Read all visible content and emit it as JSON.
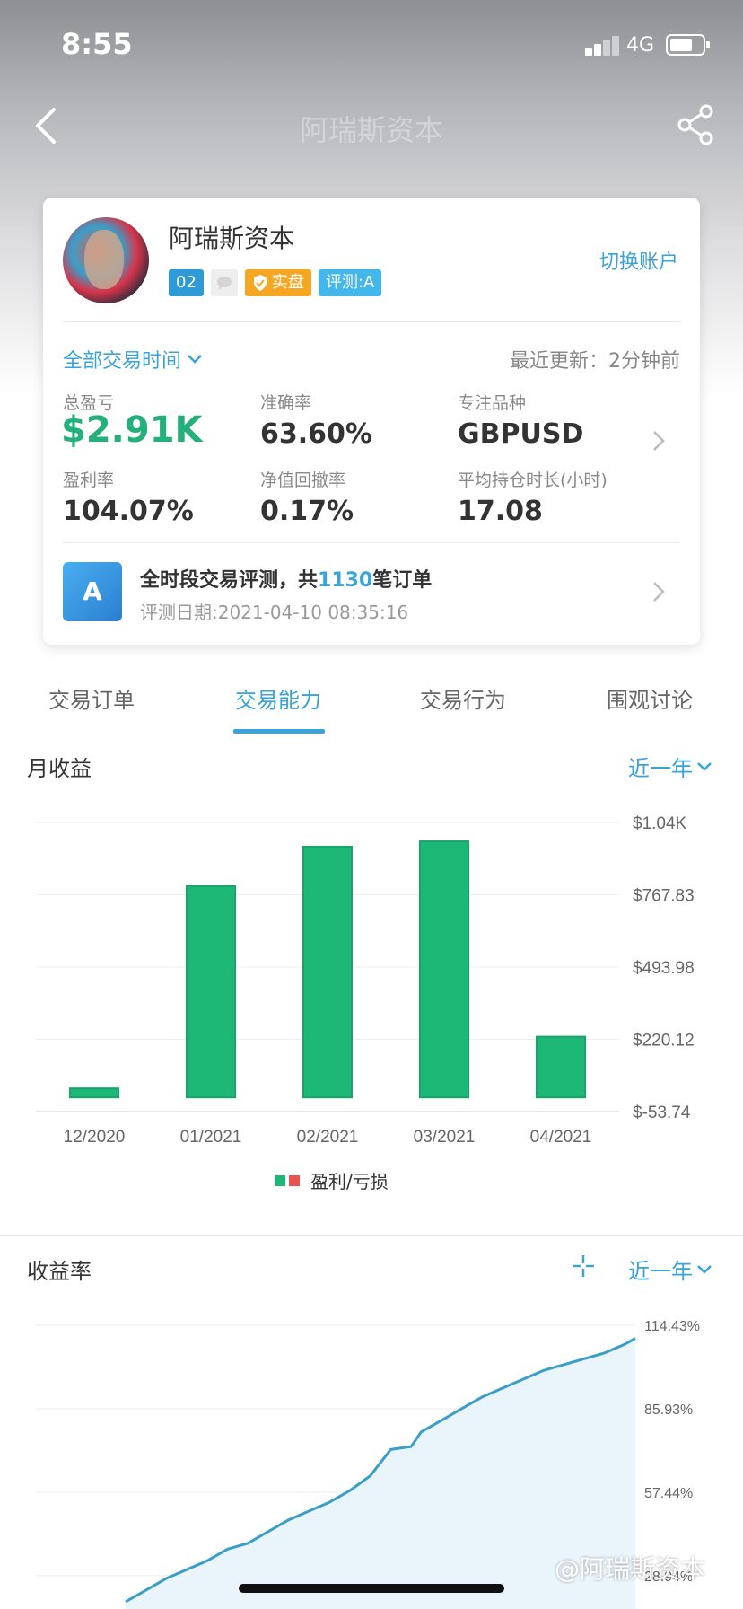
{
  "status": {
    "time": "8:55",
    "network": "4G"
  },
  "nav": {
    "title": "阿瑞斯资本"
  },
  "account": {
    "name": "阿瑞斯资本",
    "badge_level": "02",
    "badge_live": "实盘",
    "badge_rating": "评测:A",
    "switch_label": "切换账户"
  },
  "filter": {
    "period": "全部交易时间",
    "updated": "最近更新：2分钟前"
  },
  "stats": [
    {
      "label": "总盈亏",
      "value": "$2.91K"
    },
    {
      "label": "准确率",
      "value": "63.60%"
    },
    {
      "label": "专注品种",
      "value": "GBPUSD"
    },
    {
      "label": "盈利率",
      "value": "104.07%"
    },
    {
      "label": "净值回撤率",
      "value": "0.17%"
    },
    {
      "label": "平均持仓时长(小时)",
      "value": "17.08"
    }
  ],
  "evaluation": {
    "grade": "A",
    "title_prefix": "全时段交易评测，共",
    "order_count": "1130",
    "title_suffix": "笔订单",
    "date": "评测日期:2021-04-10 08:35:16"
  },
  "tabs": [
    "交易订单",
    "交易能力",
    "交易行为",
    "围观讨论"
  ],
  "active_tab": 1,
  "monthly": {
    "title": "月收益",
    "range": "近一年",
    "legend": "盈利/亏损"
  },
  "return_rate": {
    "title": "收益率",
    "range": "近一年"
  },
  "colors": {
    "accent": "#3aa3d8",
    "profit": "#1db776",
    "loss": "#e9534f",
    "line": "#3a9ec9"
  },
  "watermark": "@阿瑞斯资本",
  "chart_data": [
    {
      "type": "bar",
      "title": "月收益",
      "categories": [
        "12/2020",
        "01/2021",
        "02/2021",
        "03/2021",
        "04/2021"
      ],
      "values": [
        -40,
        800,
        950,
        970,
        230
      ],
      "yticks": [
        "$1.04K",
        "$767.83",
        "$493.98",
        "$220.12",
        "$-53.74"
      ],
      "ylim": [
        -53.74,
        1041.68
      ],
      "grid": true,
      "legend": "bottom-center"
    },
    {
      "type": "area",
      "title": "收益率",
      "yticks": [
        "114.43%",
        "85.93%",
        "57.44%",
        "28.94%"
      ],
      "ylim": [
        20,
        114.43
      ],
      "x": [
        0,
        4,
        8,
        12,
        16,
        20,
        24,
        28,
        32,
        36,
        40,
        44,
        48,
        52,
        56,
        58,
        62,
        66,
        70,
        74,
        78,
        82,
        86,
        90,
        94,
        98,
        100
      ],
      "values": [
        20,
        24,
        28,
        31,
        34,
        38,
        40,
        44,
        48,
        51,
        54,
        58,
        63,
        72,
        73,
        78,
        82,
        86,
        90,
        93,
        96,
        99,
        101,
        103,
        105,
        108,
        110
      ],
      "grid": true
    }
  ]
}
